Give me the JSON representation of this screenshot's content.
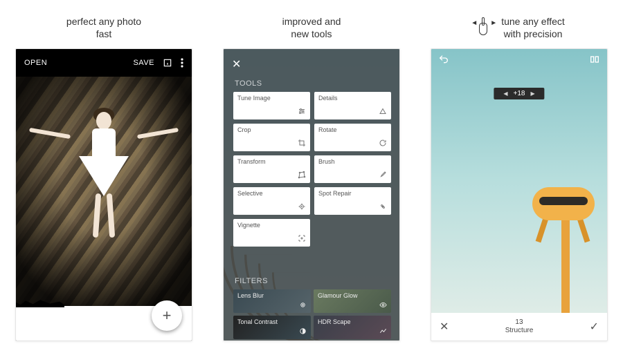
{
  "shots": [
    {
      "caption_line1": "perfect any photo",
      "caption_line2": "fast",
      "open": "OPEN",
      "save": "SAVE",
      "fab": "+"
    },
    {
      "caption_line1": "improved and",
      "caption_line2": "new tools",
      "tools_label": "TOOLS",
      "filters_label": "FILTERS",
      "tools": [
        {
          "label": "Tune Image",
          "icon": "sliders"
        },
        {
          "label": "Details",
          "icon": "triangle"
        },
        {
          "label": "Crop",
          "icon": "crop"
        },
        {
          "label": "Rotate",
          "icon": "rotate"
        },
        {
          "label": "Transform",
          "icon": "transform"
        },
        {
          "label": "Brush",
          "icon": "brush"
        },
        {
          "label": "Selective",
          "icon": "target"
        },
        {
          "label": "Spot Repair",
          "icon": "heal"
        },
        {
          "label": "Vignette",
          "icon": "vignette"
        }
      ],
      "filters": [
        {
          "label": "Lens Blur",
          "icon": "blur"
        },
        {
          "label": "Glamour Glow",
          "icon": "eye"
        },
        {
          "label": "Tonal Contrast",
          "icon": "contrast"
        },
        {
          "label": "HDR Scape",
          "icon": "hdr"
        }
      ]
    },
    {
      "caption_line1": "tune any effect",
      "caption_line2": "with precision",
      "pill_value": "+18",
      "bottom_value": "13",
      "bottom_label": "Structure"
    }
  ]
}
